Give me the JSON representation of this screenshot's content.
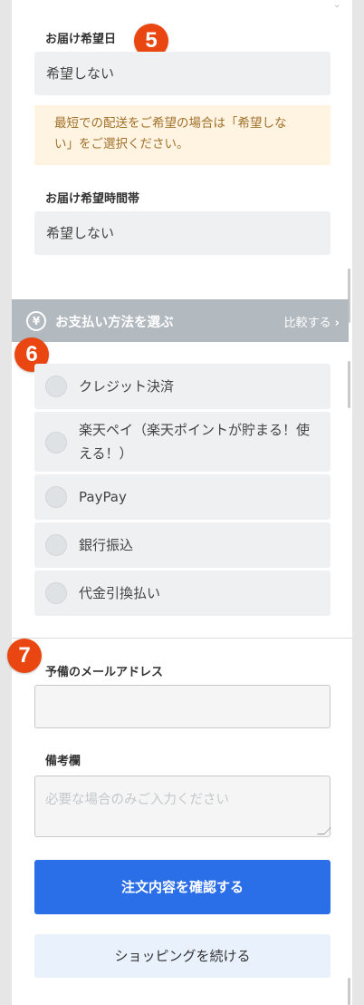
{
  "delivery": {
    "date_label": "お届け希望日",
    "date_value": "希望しない",
    "notice_line1": "最短での配送をご希望の場合は「希望しな",
    "notice_line2": "い」をご選択ください。",
    "time_label": "お届け希望時間帯",
    "time_value": "希望しない"
  },
  "badges": {
    "step5": "5",
    "step6": "6",
    "step7": "7"
  },
  "payment": {
    "icon": "yen-icon",
    "title": "お支払い方法を選ぶ",
    "compare_label": "比較する",
    "options": [
      {
        "label": "クレジット決済"
      },
      {
        "label": "楽天ペイ（楽天ポイントが貯まる！使える！）"
      },
      {
        "label": "PayPay"
      },
      {
        "label": "銀行振込"
      },
      {
        "label": "代金引換払い"
      }
    ]
  },
  "contact": {
    "email_label": "予備のメールアドレス",
    "email_value": "",
    "notes_label": "備考欄",
    "notes_placeholder": "必要な場合のみご入力ください"
  },
  "actions": {
    "confirm_label": "注文内容を確認する",
    "continue_label": "ショッピングを続ける"
  },
  "colors": {
    "badge": "#ea4611",
    "primary_button": "#2b6fe8",
    "notice_bg": "#fff3e2",
    "notice_text": "#a2722b",
    "section_header": "#b2b9bf"
  }
}
